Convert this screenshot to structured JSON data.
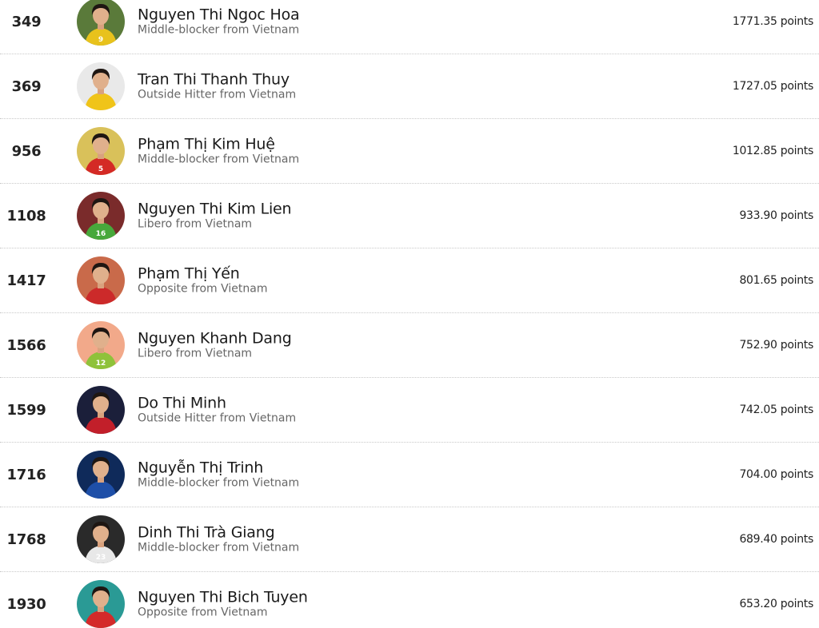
{
  "players": [
    {
      "rank": "349",
      "name": "Nguyen Thi Ngoc Hoa",
      "subtitle": "Middle-blocker from Vietnam",
      "points": "1771.35 points",
      "avatar_bg": "#5a7a3a",
      "jersey": "#e8c21c",
      "jersey_num": "9"
    },
    {
      "rank": "369",
      "name": "Tran Thi Thanh Thuy",
      "subtitle": "Outside Hitter from Vietnam",
      "points": "1727.05 points",
      "avatar_bg": "#e9e9e9",
      "jersey": "#f0c419",
      "jersey_num": ""
    },
    {
      "rank": "956",
      "name": "Phạm Thị Kim Huệ",
      "subtitle": "Middle-blocker from Vietnam",
      "points": "1012.85 points",
      "avatar_bg": "#d9c15a",
      "jersey": "#d42a25",
      "jersey_num": "5"
    },
    {
      "rank": "1108",
      "name": "Nguyen Thi Kim Lien",
      "subtitle": "Libero from Vietnam",
      "points": "933.90 points",
      "avatar_bg": "#7a2b2b",
      "jersey": "#47a83b",
      "jersey_num": "16"
    },
    {
      "rank": "1417",
      "name": "Phạm Thị Yến",
      "subtitle": "Opposite from Vietnam",
      "points": "801.65 points",
      "avatar_bg": "#c96a4a",
      "jersey": "#cc2a2a",
      "jersey_num": ""
    },
    {
      "rank": "1566",
      "name": "Nguyen Khanh Dang",
      "subtitle": "Libero from Vietnam",
      "points": "752.90 points",
      "avatar_bg": "#f2a98a",
      "jersey": "#8fc23a",
      "jersey_num": "12"
    },
    {
      "rank": "1599",
      "name": "Do Thi Minh",
      "subtitle": "Outside Hitter from Vietnam",
      "points": "742.05 points",
      "avatar_bg": "#1b1f3a",
      "jersey": "#c21f2a",
      "jersey_num": ""
    },
    {
      "rank": "1716",
      "name": "Nguyễn Thị Trinh",
      "subtitle": "Middle-blocker from Vietnam",
      "points": "704.00 points",
      "avatar_bg": "#0f2a5a",
      "jersey": "#1e4fa8",
      "jersey_num": ""
    },
    {
      "rank": "1768",
      "name": "Dinh Thi Trà Giang",
      "subtitle": "Middle-blocker from Vietnam",
      "points": "689.40 points",
      "avatar_bg": "#2a2a2a",
      "jersey": "#e8e8e8",
      "jersey_num": "23"
    },
    {
      "rank": "1930",
      "name": "Nguyen Thi Bich Tuyen",
      "subtitle": "Opposite from Vietnam",
      "points": "653.20 points",
      "avatar_bg": "#2a9a95",
      "jersey": "#d42a2a",
      "jersey_num": ""
    }
  ]
}
